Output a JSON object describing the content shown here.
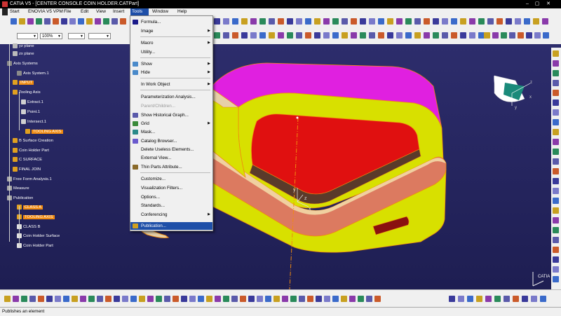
{
  "window": {
    "title": "CATIA V5 - [CENTER CONSOLE COIN HOLDER.CATPart]"
  },
  "menubar": [
    "Start",
    "ENOVIA V5 VPM",
    "File",
    "Edit",
    "View",
    "Insert",
    "Tools",
    "Window",
    "Help"
  ],
  "toolbar": {
    "zoom_value": "100%"
  },
  "tools_menu": [
    {
      "label": "Formula..."
    },
    {
      "label": "Image",
      "submenu": true
    },
    {
      "label": "Macro",
      "submenu": true
    },
    {
      "label": "Utility..."
    },
    {
      "label": "Show",
      "submenu": true
    },
    {
      "label": "Hide",
      "submenu": true
    },
    {
      "label": "In Work Object",
      "submenu": true
    },
    {
      "label": "Parameterization Analysis..."
    },
    {
      "label": "Parent/Children...",
      "disabled": true
    },
    {
      "label": "Show Historical Graph..."
    },
    {
      "label": "Grid",
      "submenu": true
    },
    {
      "label": "Mask..."
    },
    {
      "label": "Catalog Browser..."
    },
    {
      "label": "Delete Useless Elements..."
    },
    {
      "label": "External View..."
    },
    {
      "label": "Thin Parts Attribute..."
    },
    {
      "label": "Customize..."
    },
    {
      "label": "Visualization Filters..."
    },
    {
      "label": "Options..."
    },
    {
      "label": "Standards..."
    },
    {
      "label": "Conferencing",
      "submenu": true
    },
    {
      "label": "Publication...",
      "selected": true
    }
  ],
  "tree": [
    {
      "label": "yz plane"
    },
    {
      "label": "zx plane"
    },
    {
      "label": "Axis Systems"
    },
    {
      "label": "Axis System.1"
    },
    {
      "label": "INPUT",
      "highlight": true
    },
    {
      "label": "Tooling Axis"
    },
    {
      "label": "Extract.1"
    },
    {
      "label": "Point.1"
    },
    {
      "label": "Intersect.1"
    },
    {
      "label": "TOOLING AXIS",
      "highlight": true
    },
    {
      "label": "B Surface Creation"
    },
    {
      "label": "Coin Holder Part"
    },
    {
      "label": "C SURFACE"
    },
    {
      "label": "FINAL JOIN"
    },
    {
      "label": "Free Form Analysis.1"
    },
    {
      "label": "Measure"
    },
    {
      "label": "Publication"
    },
    {
      "label": "CLASS A",
      "highlight": true
    },
    {
      "label": "TOOLING AXIS",
      "highlight": true
    },
    {
      "label": "CLASS B"
    },
    {
      "label": "Coin Holder Surface"
    },
    {
      "label": "Coin Holder Part"
    }
  ],
  "compass": {
    "x": "x",
    "y": "y",
    "z": "z"
  },
  "part_axis": {
    "x": "x",
    "y": "y",
    "z": "z"
  },
  "brand": "CATIA",
  "status": {
    "message": "Publishes an element"
  }
}
